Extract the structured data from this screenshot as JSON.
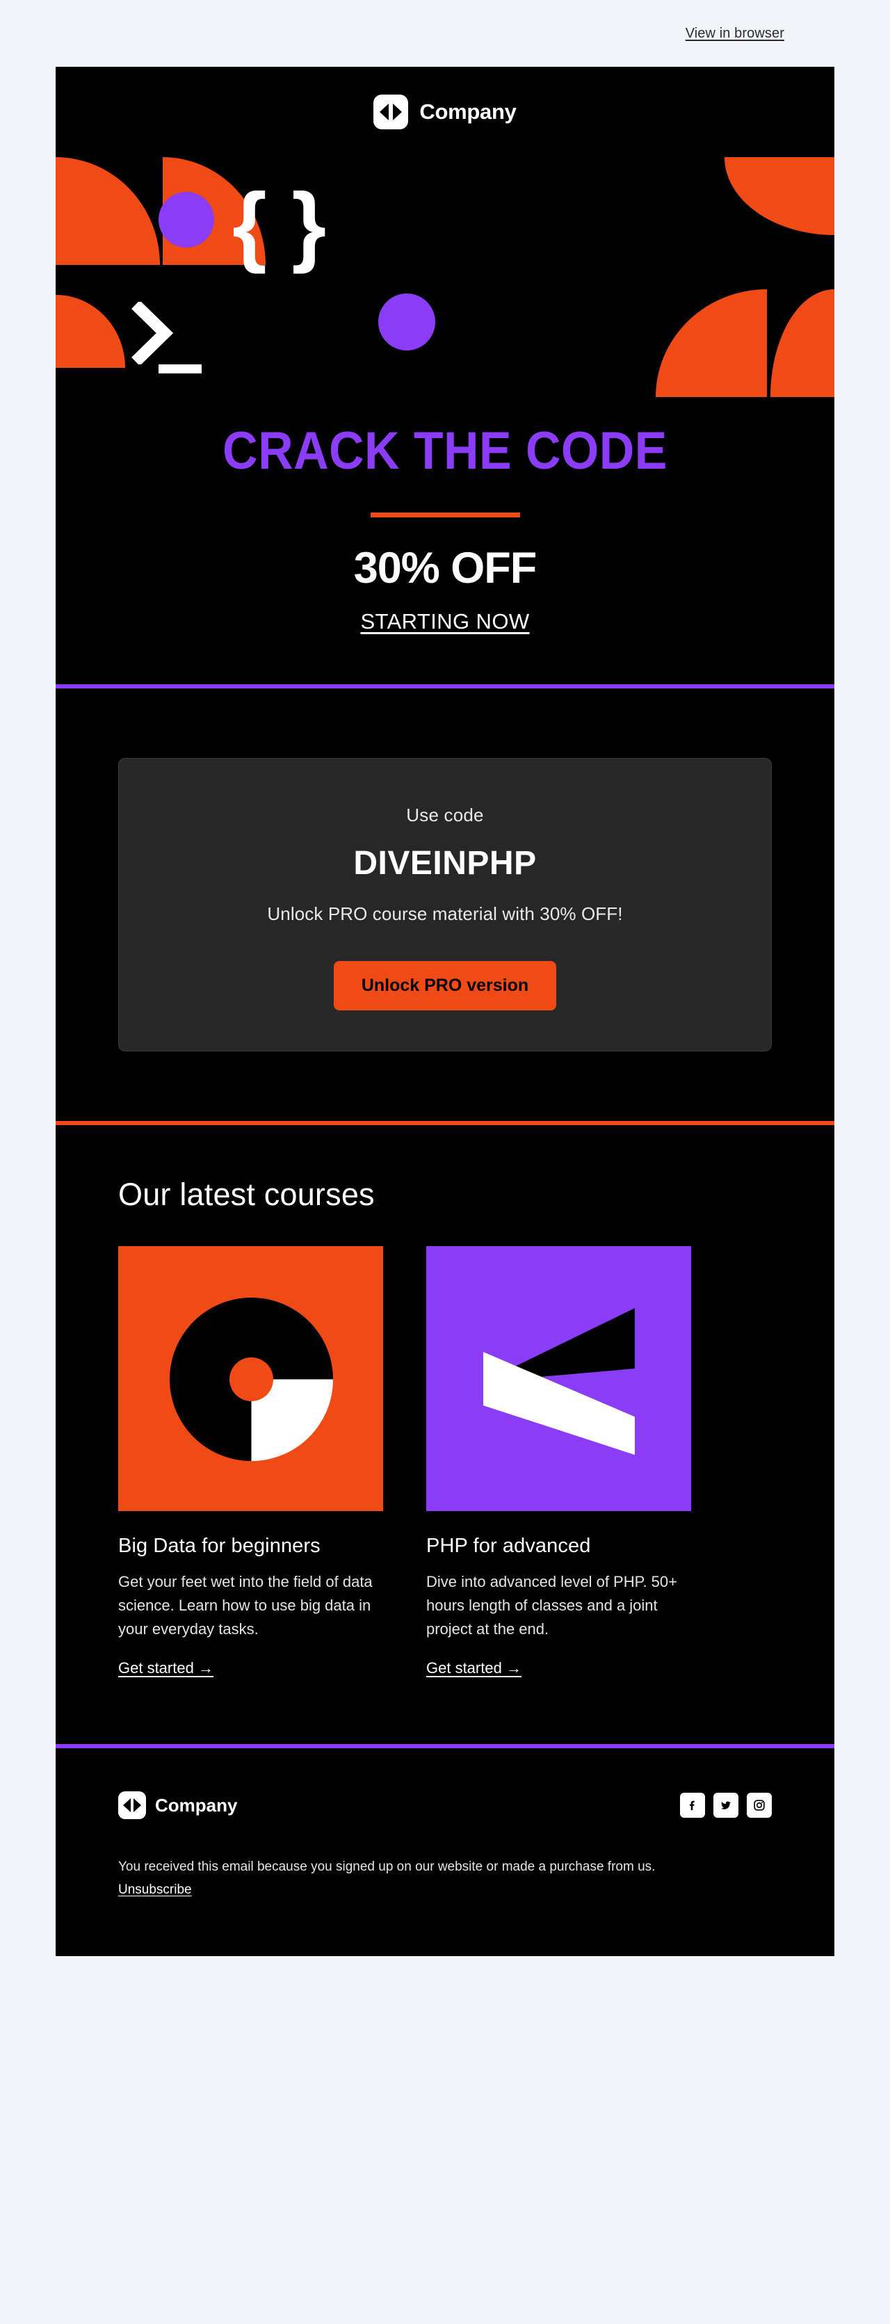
{
  "preheader": {
    "view_in_browser": "View in browser"
  },
  "header": {
    "brand_name": "Company",
    "logo_icon": "company-play-mark-icon"
  },
  "hero": {
    "graphic_icons": {
      "braces": "{ }",
      "prompt_chevron": "terminal-chevron-icon",
      "prompt_underscore": "terminal-cursor-icon"
    },
    "headline": "CRACK THE CODE",
    "discount": "30% OFF",
    "cta_link": "STARTING NOW"
  },
  "promo": {
    "use_code_label": "Use code",
    "code": "DIVEINPHP",
    "description": "Unlock PRO course material with 30% OFF!",
    "button_label": "Unlock PRO version"
  },
  "courses": {
    "section_title": "Our latest courses",
    "items": [
      {
        "thumb_icon": "pie-chart-graphic",
        "title": "Big Data for beginners",
        "description": "Get your feet wet into the field of data science. Learn how to use big data in your everyday tasks.",
        "link_label": "Get started →"
      },
      {
        "thumb_icon": "angular-flag-graphic",
        "title": "PHP for advanced",
        "description": "Dive into advanced level of PHP. 50+ hours length of classes and a joint project at the end.",
        "link_label": "Get started →"
      }
    ]
  },
  "footer": {
    "brand_name": "Company",
    "socials": [
      {
        "name": "facebook-icon",
        "label": "Facebook"
      },
      {
        "name": "twitter-icon",
        "label": "Twitter"
      },
      {
        "name": "instagram-icon",
        "label": "Instagram"
      }
    ],
    "legal_text": "You received this email because you signed up on our website or made a purchase from us.",
    "unsubscribe_label": "Unsubscribe"
  },
  "colors": {
    "background": "#f1f5f9",
    "email_background": "#000000",
    "accent_orange": "#f04a17",
    "accent_purple": "#8b3cf7",
    "card_background": "#272727",
    "text_light": "#ffffff"
  }
}
